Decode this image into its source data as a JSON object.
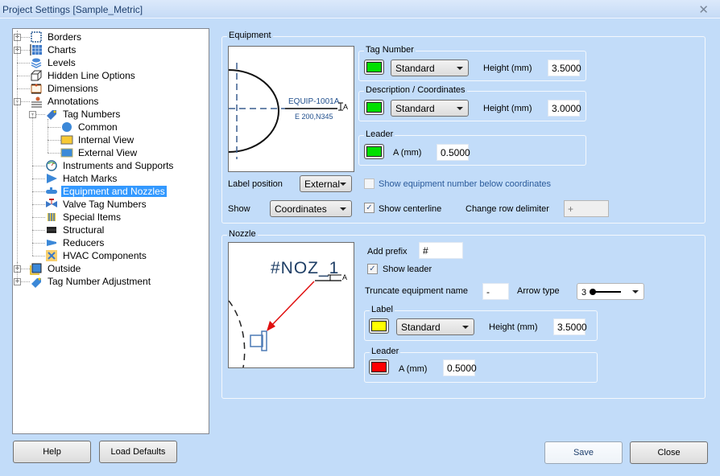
{
  "window": {
    "title": "Project Settings [Sample_Metric]",
    "close_glyph": "✕"
  },
  "tree": {
    "items": [
      {
        "label": "Borders",
        "icon": "borders-icon",
        "level": 0,
        "expander": "+"
      },
      {
        "label": "Charts",
        "icon": "charts-icon",
        "level": 0,
        "expander": "+"
      },
      {
        "label": "Levels",
        "icon": "levels-icon",
        "level": 0,
        "expander": ""
      },
      {
        "label": "Hidden Line Options",
        "icon": "hidden-line-icon",
        "level": 0,
        "expander": ""
      },
      {
        "label": "Dimensions",
        "icon": "dimensions-icon",
        "level": 0,
        "expander": ""
      },
      {
        "label": "Annotations",
        "icon": "annotations-icon",
        "level": 0,
        "expander": "−"
      },
      {
        "label": "Tag Numbers",
        "icon": "tag-icon",
        "level": 1,
        "expander": "−"
      },
      {
        "label": "Common",
        "icon": "circle-icon",
        "level": 2,
        "expander": ""
      },
      {
        "label": "Internal View",
        "icon": "internal-view-icon",
        "level": 2,
        "expander": ""
      },
      {
        "label": "External View",
        "icon": "external-view-icon",
        "level": 2,
        "expander": ""
      },
      {
        "label": "Instruments and Supports",
        "icon": "instrument-gauge-icon",
        "level": 1,
        "expander": ""
      },
      {
        "label": "Hatch Marks",
        "icon": "hatch-marks-icon",
        "level": 1,
        "expander": ""
      },
      {
        "label": "Equipment and Nozzles",
        "icon": "equipment-icon",
        "level": 1,
        "expander": "",
        "selected": true
      },
      {
        "label": "Valve Tag Numbers",
        "icon": "valve-icon",
        "level": 1,
        "expander": ""
      },
      {
        "label": "Special Items",
        "icon": "special-items-icon",
        "level": 1,
        "expander": ""
      },
      {
        "label": "Structural",
        "icon": "structural-icon",
        "level": 1,
        "expander": ""
      },
      {
        "label": "Reducers",
        "icon": "reducer-icon",
        "level": 1,
        "expander": ""
      },
      {
        "label": "HVAC Components",
        "icon": "hvac-icon",
        "level": 1,
        "expander": ""
      },
      {
        "label": "Outside",
        "icon": "outside-icon",
        "level": 0,
        "expander": "+"
      },
      {
        "label": "Tag Number Adjustment",
        "icon": "tag-adjust-icon",
        "level": 0,
        "expander": "+"
      }
    ]
  },
  "equipment": {
    "title": "Equipment",
    "preview": {
      "tag": "EQUIP-1001A",
      "coords": "E 200,N345",
      "dim_label": "A"
    },
    "tag_number": {
      "title": "Tag Number",
      "color": "#00e000",
      "style": "Standard",
      "height_label": "Height (mm)",
      "height": "3.5000"
    },
    "description": {
      "title": "Description / Coordinates",
      "color": "#00e000",
      "style": "Standard",
      "height_label": "Height (mm)",
      "height": "3.0000"
    },
    "leader": {
      "title": "Leader",
      "color": "#00e000",
      "a_label": "A (mm)",
      "a_value": "0.5000"
    },
    "label_position_label": "Label position",
    "label_position": "External",
    "show_equipment_number_label": "Show equipment number below coordinates",
    "show_equipment_number_checked": false,
    "show_label": "Show",
    "show_value": "Coordinates",
    "show_centerline_label": "Show centerline",
    "show_centerline_checked": true,
    "checkmark": "✓",
    "row_delimiter_label": "Change row delimiter",
    "row_delimiter_value": "+"
  },
  "nozzle": {
    "title": "Nozzle",
    "preview": {
      "tag": "#NOZ_1",
      "dim_label": "A"
    },
    "add_prefix_label": "Add prefix",
    "add_prefix_value": "#",
    "show_leader_label": "Show leader",
    "show_leader_checked": true,
    "truncate_label": "Truncate equipment name",
    "truncate_value": "-",
    "arrow_type_label": "Arrow type",
    "arrow_type_value": "3",
    "label": {
      "title": "Label",
      "color": "#ffff00",
      "style": "Standard",
      "height_label": "Height (mm)",
      "height": "3.5000"
    },
    "leader": {
      "title": "Leader",
      "color": "#ff0000",
      "a_label": "A (mm)",
      "a_value": "0.5000"
    }
  },
  "buttons": {
    "help": "Help",
    "load_defaults": "Load Defaults",
    "save": "Save",
    "close": "Close"
  }
}
